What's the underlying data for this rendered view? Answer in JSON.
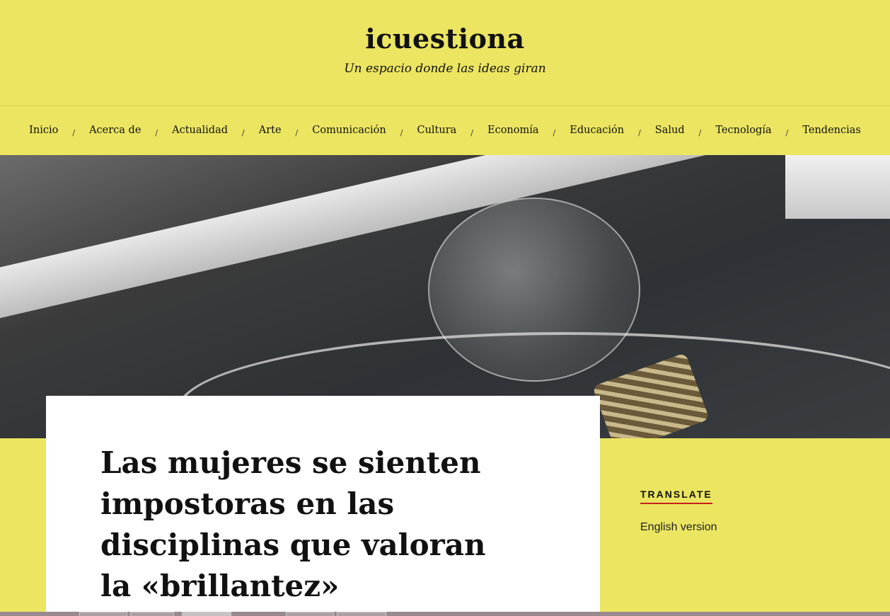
{
  "site": {
    "title": "icuestiona",
    "tagline": "Un espacio donde las ideas giran"
  },
  "nav": {
    "separator": "/",
    "items": [
      {
        "label": "Inicio"
      },
      {
        "label": "Acerca de"
      },
      {
        "label": "Actualidad"
      },
      {
        "label": "Arte"
      },
      {
        "label": "Comunicación"
      },
      {
        "label": "Cultura"
      },
      {
        "label": "Economía"
      },
      {
        "label": "Educación"
      },
      {
        "label": "Salud"
      },
      {
        "label": "Tecnología"
      },
      {
        "label": "Tendencias"
      }
    ]
  },
  "article": {
    "title": "Las mujeres se sienten impostoras en las disciplinas que valoran la «brillantez»"
  },
  "sidebar": {
    "widget_title": "TRANSLATE",
    "link": "English version"
  },
  "colors": {
    "background": "#ebe561",
    "accent": "#c8201e"
  }
}
